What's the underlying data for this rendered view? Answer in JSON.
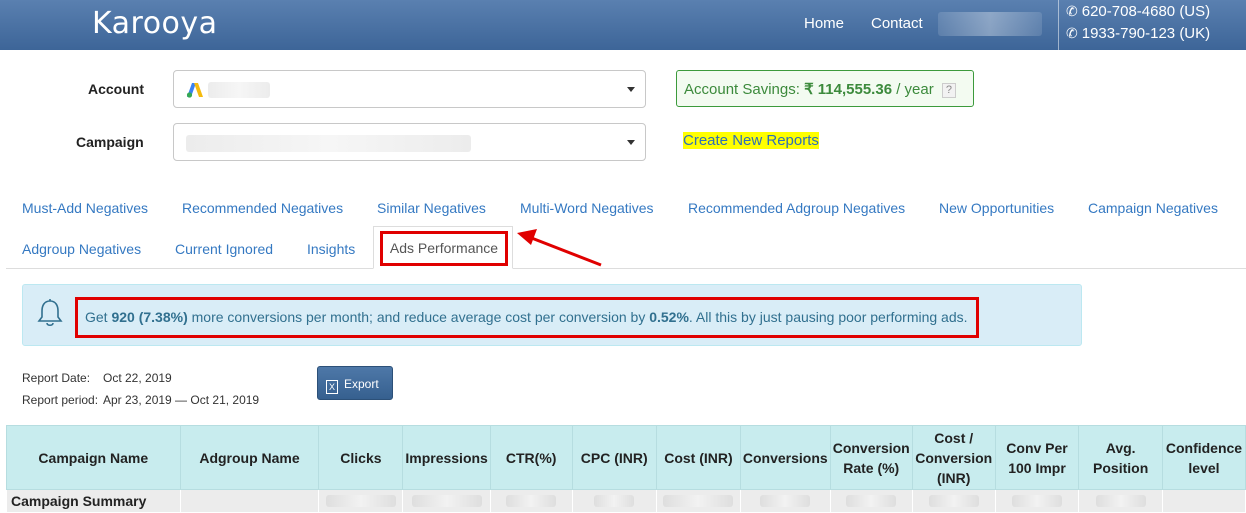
{
  "header": {
    "logo": "Karooya",
    "nav": [
      "Home",
      "Contact"
    ],
    "phones": [
      "620-708-4680 (US)",
      "1933-790-123 (UK)"
    ]
  },
  "form": {
    "account_label": "Account",
    "campaign_label": "Campaign",
    "savings_prefix": "Account Savings:",
    "savings_amount": "₹ 114,555.36",
    "savings_suffix": "/ year",
    "savings_help": "?",
    "create_reports": "Create New Reports"
  },
  "tabs": [
    "Must-Add Negatives",
    "Recommended Negatives",
    "Similar Negatives",
    "Multi-Word Negatives",
    "Recommended Adgroup Negatives",
    "New Opportunities",
    "Campaign Negatives",
    "Adgroup Negatives",
    "Current Ignored",
    "Insights",
    "Ads Performance"
  ],
  "active_tab": "Ads Performance",
  "alert": {
    "t1": "Get ",
    "b1": "920 (7.38%)",
    "t2": " more conversions per month; and reduce average cost per conversion by ",
    "b2": "0.52%",
    "t3": ". All this by just pausing poor performing ads."
  },
  "report": {
    "date_label": "Report Date:",
    "date_value": "Oct 22, 2019",
    "period_label": "Report period:",
    "period_value": "Apr 23, 2019 — Oct 21, 2019",
    "export_label": "Export"
  },
  "table": {
    "headers": [
      "Campaign Name",
      "Adgroup Name",
      "Clicks",
      "Impressions",
      "CTR(%)",
      "CPC (INR)",
      "Cost (INR)",
      "Conversions",
      "Conversion Rate (%)",
      "Cost / Conversion (INR)",
      "Conv Per 100 Impr",
      "Avg. Position",
      "Confidence level"
    ],
    "summary_label": "Campaign Summary"
  },
  "colors": {
    "header_bg": "#4a72a5",
    "link": "#3579c2",
    "highlight": "#e00000",
    "alert_bg": "#d9edf7",
    "table_header_bg": "#c8ecee"
  }
}
